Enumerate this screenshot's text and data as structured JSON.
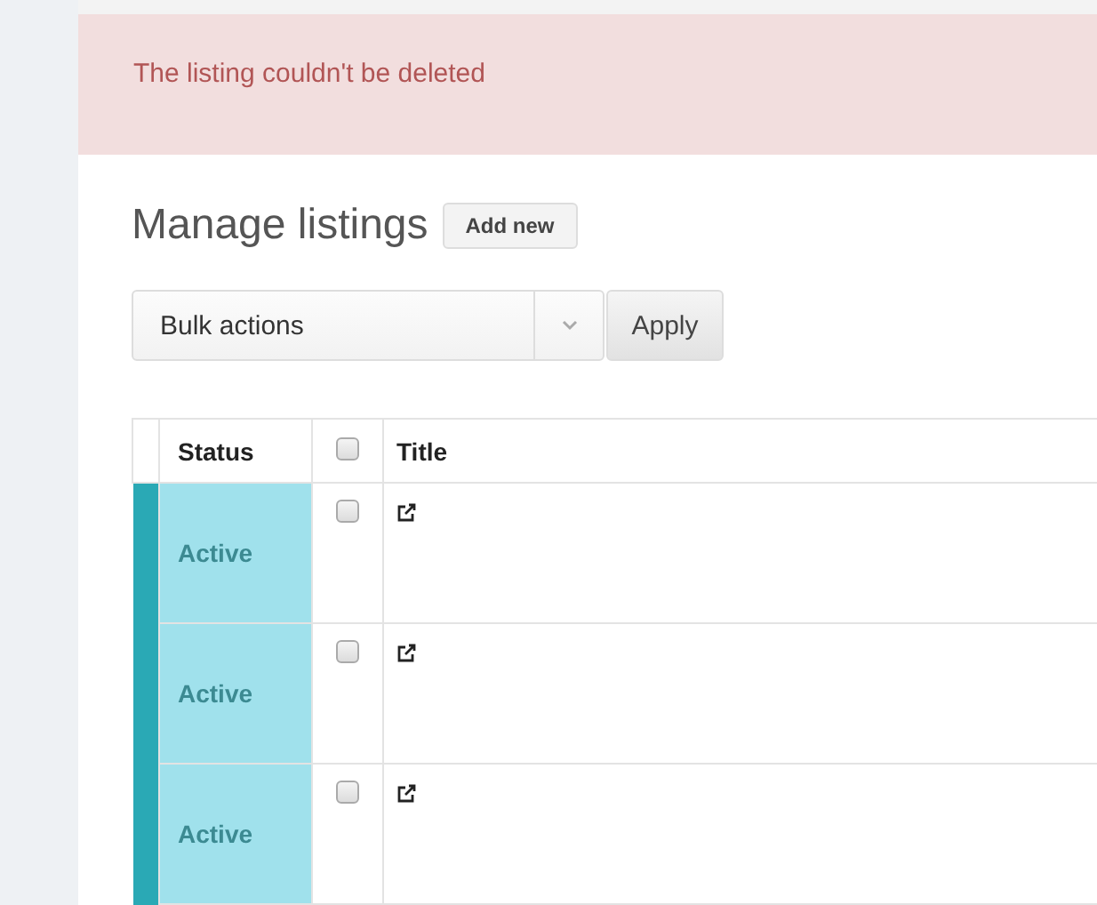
{
  "alert": {
    "message": "The listing couldn't be deleted"
  },
  "heading": {
    "title": "Manage listings",
    "add_button": "Add new"
  },
  "bulk": {
    "value": "Bulk actions",
    "apply": "Apply"
  },
  "table": {
    "columns": [
      "Status",
      "Title"
    ],
    "select_all_checked": false,
    "rows": [
      {
        "status": "Active",
        "color": "#2aa9b5",
        "checked": false
      },
      {
        "status": "Active",
        "color": "#2aa9b5",
        "checked": false
      },
      {
        "status": "Active",
        "color": "#2aa9b5",
        "checked": false
      }
    ]
  }
}
